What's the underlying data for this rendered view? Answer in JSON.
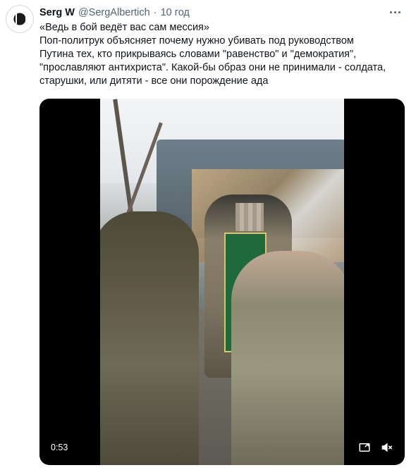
{
  "author": {
    "display_name": "Serg W",
    "handle": "@SergAlbertich",
    "separator": "·",
    "time": "10 год"
  },
  "tweet": {
    "lines": [
      "«Ведь в бой ведёт вас сам мессия»",
      "Поп-политрук объясняет почему нужно убивать под руководством",
      "Путина тех, кто прикрываясь словами \"равенство\" и \"демократия\",",
      "\"прославляют антихриста\". Какой-бы образ они не принимали - солдата,",
      "старушки, или дитяти -  все они порождение ада"
    ]
  },
  "media": {
    "duration": "0:53",
    "icons": {
      "more": "more-dots-icon",
      "pip": "picture-in-picture-icon",
      "mute": "volume-muted-icon"
    }
  }
}
